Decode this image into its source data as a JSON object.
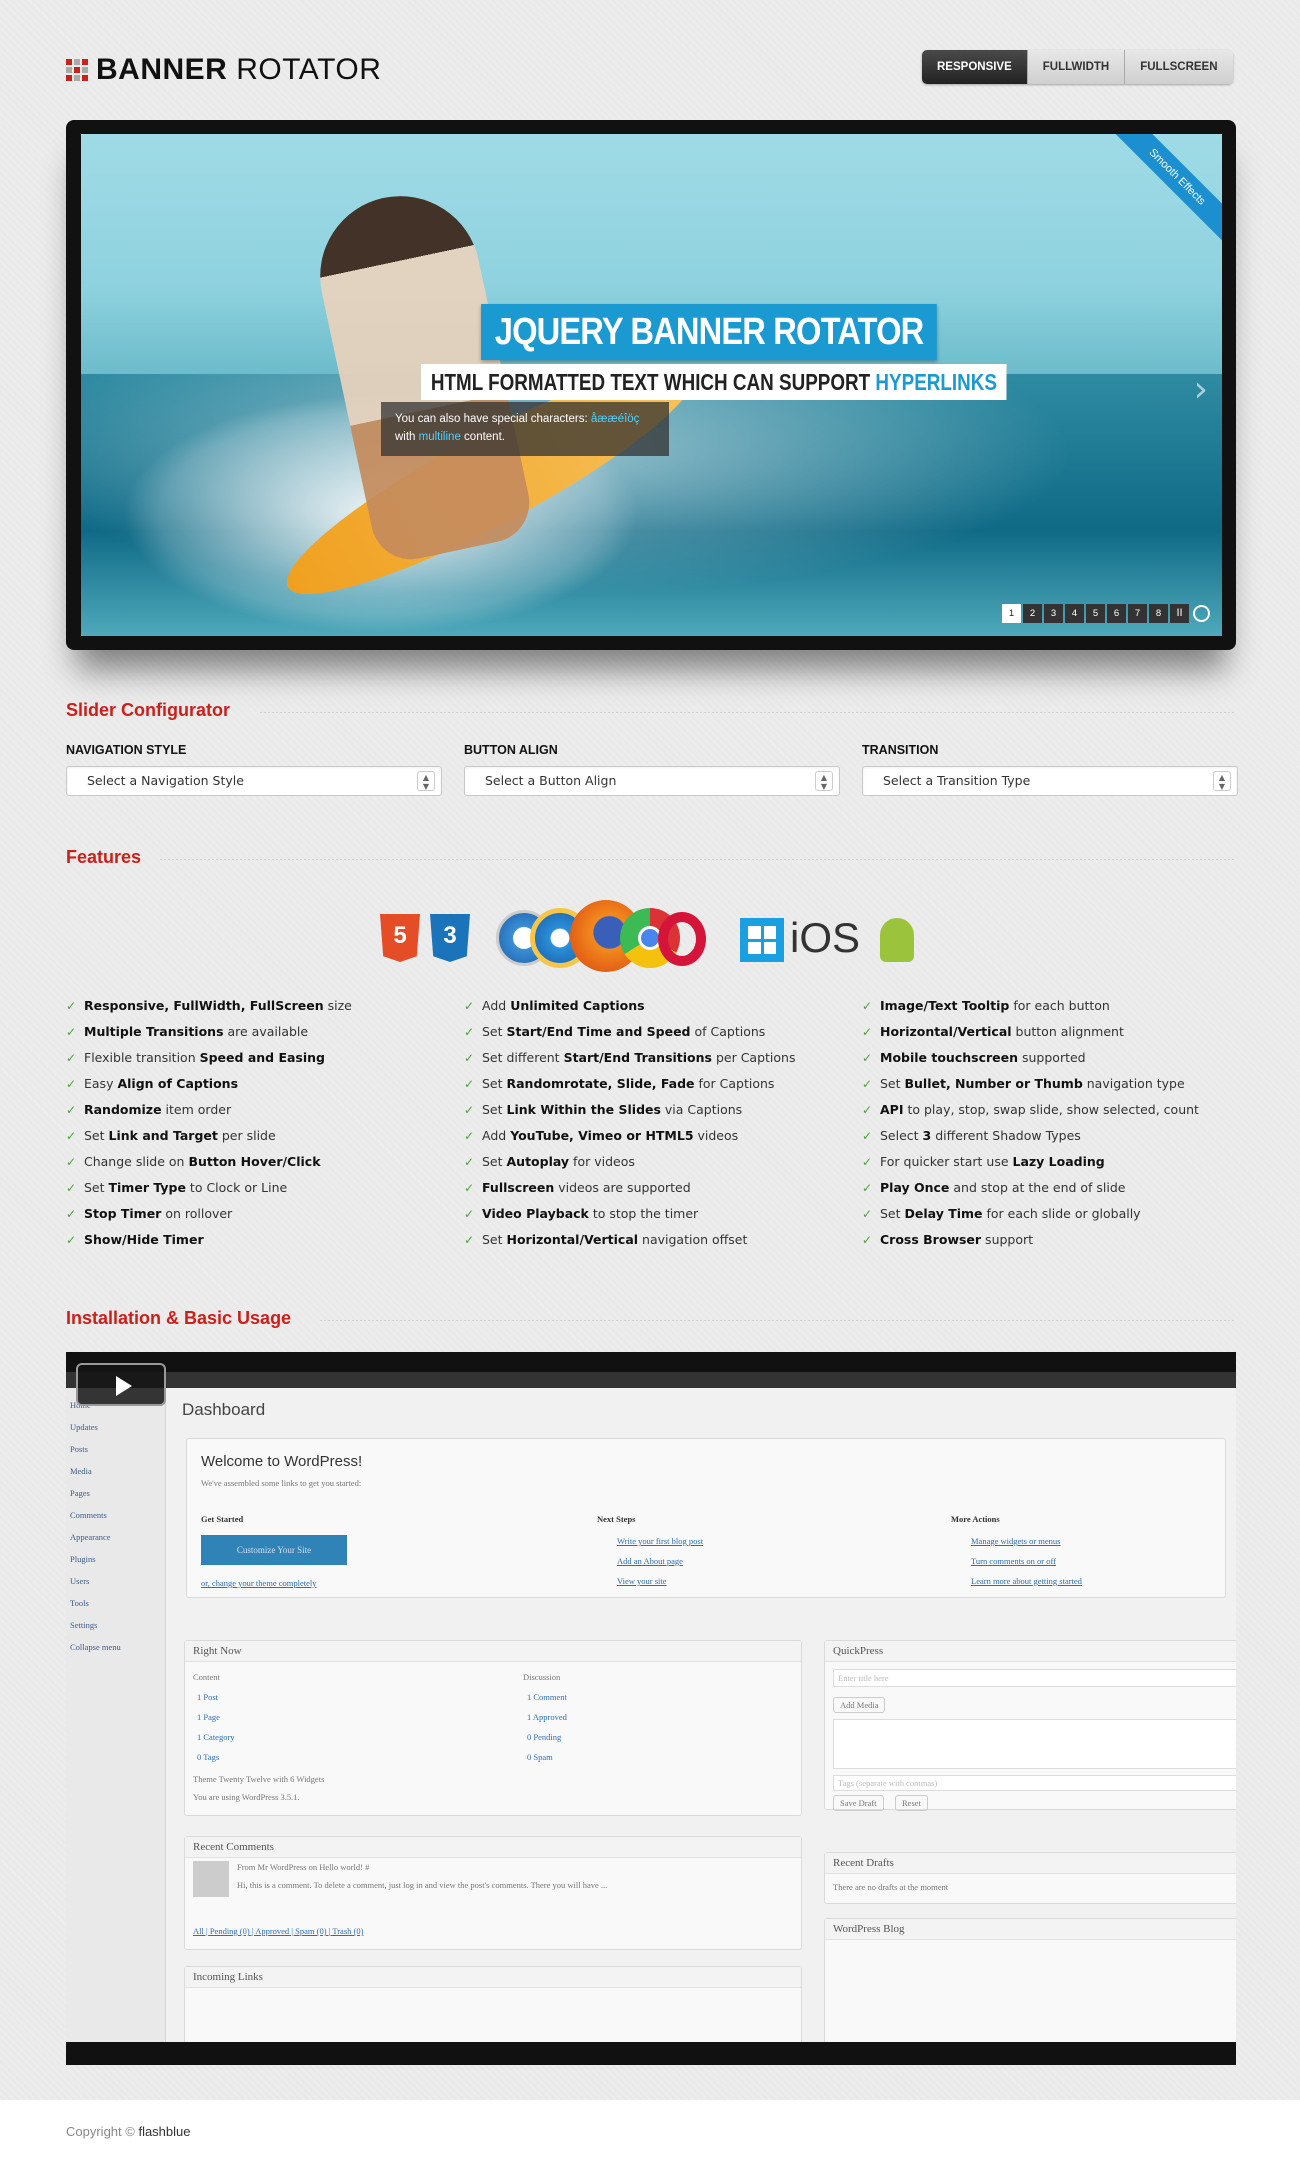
{
  "header": {
    "logo_bold": "BANNER",
    "logo_light": "ROTATOR",
    "modes": [
      "RESPONSIVE",
      "FULLWIDTH",
      "FULLSCREEN"
    ]
  },
  "banner": {
    "ribbon": "Smooth Effects",
    "caption_title": "JQUERY BANNER ROTATOR",
    "caption_sub": "HTML FORMATTED TEXT WHICH CAN SUPPORT",
    "caption_sub_highlight": "HYPERLINKS",
    "caption_text_1": "You can also have special characters:",
    "caption_text_chars": "åææéîöç",
    "caption_text_2": "with",
    "caption_text_hl": "multiline",
    "caption_text_3": "content.",
    "pages": [
      "1",
      "2",
      "3",
      "4",
      "5",
      "6",
      "7",
      "8"
    ],
    "current_page": "1",
    "pause": "II"
  },
  "configurator": {
    "title": "Slider Configurator",
    "fields": [
      {
        "label": "NAVIGATION STYLE",
        "placeholder": "Select a Navigation Style"
      },
      {
        "label": "BUTTON ALIGN",
        "placeholder": "Select a Button Align"
      },
      {
        "label": "TRANSITION",
        "placeholder": "Select a Transition Type"
      }
    ]
  },
  "features": {
    "title": "Features",
    "icons": [
      "html5",
      "css3",
      "safari",
      "ie",
      "firefox",
      "chrome",
      "opera",
      "windows",
      "iOS",
      "android"
    ],
    "col1": [
      [
        "",
        "Responsive, FullWidth, FullScreen",
        " size"
      ],
      [
        "",
        "Multiple Transitions",
        " are available"
      ],
      [
        "Flexible transition ",
        "Speed and Easing",
        ""
      ],
      [
        "Easy ",
        "Align of Captions",
        ""
      ],
      [
        "",
        "Randomize",
        " item order"
      ],
      [
        "Set ",
        "Link and Target",
        " per slide"
      ],
      [
        "Change slide on ",
        "Button Hover/Click",
        ""
      ],
      [
        "Set ",
        "Timer Type",
        " to Clock or Line"
      ],
      [
        "",
        "Stop Timer",
        " on rollover"
      ],
      [
        "",
        "Show/Hide Timer",
        ""
      ]
    ],
    "col2": [
      [
        "Add ",
        "Unlimited Captions",
        ""
      ],
      [
        "Set ",
        "Start/End Time and Speed",
        " of Captions"
      ],
      [
        "Set different ",
        "Start/End Transitions",
        " per Captions"
      ],
      [
        "Set ",
        "Randomrotate, Slide, Fade",
        " for Captions"
      ],
      [
        "Set ",
        "Link Within the Slides",
        " via Captions"
      ],
      [
        "Add ",
        "YouTube, Vimeo or HTML5",
        " videos"
      ],
      [
        "Set ",
        "Autoplay",
        " for videos"
      ],
      [
        "",
        "Fullscreen",
        " videos are supported"
      ],
      [
        "",
        "Video Playback",
        " to stop the timer"
      ],
      [
        "Set ",
        "Horizontal/Vertical",
        " navigation offset"
      ]
    ],
    "col3": [
      [
        "",
        "Image/Text Tooltip",
        " for each button"
      ],
      [
        "",
        "Horizontal/Vertical",
        " button alignment"
      ],
      [
        "",
        "Mobile touchscreen",
        " supported"
      ],
      [
        "Set ",
        "Bullet, Number or Thumb",
        " navigation type"
      ],
      [
        "",
        "API",
        " to play, stop, swap slide, show selected, count"
      ],
      [
        "Select ",
        "3",
        " different Shadow Types"
      ],
      [
        "For quicker start use ",
        "Lazy Loading",
        ""
      ],
      [
        "",
        "Play Once",
        " and stop at the end of slide"
      ],
      [
        "Set ",
        "Delay Time",
        " for each slide or globally"
      ],
      [
        "",
        "Cross Browser",
        " support"
      ]
    ]
  },
  "install": {
    "title": "Installation & Basic Usage",
    "wp": {
      "dashboard": "Dashboard",
      "welcome": "Welcome to WordPress!",
      "welcome_sub": "We've assembled some links to get you started:",
      "get_started": "Get Started",
      "customize": "Customize Your Site",
      "or_change": "or, change your theme completely",
      "next_steps": "Next Steps",
      "ns": [
        "Write your first blog post",
        "Add an About page",
        "View your site"
      ],
      "more_actions": "More Actions",
      "ma": [
        "Manage widgets or menus",
        "Turn comments on or off",
        "Learn more about getting started"
      ],
      "right_now": "Right Now",
      "content": "Content",
      "discussion": "Discussion",
      "rn_left": [
        "1 Post",
        "1 Page",
        "1 Category",
        "0 Tags"
      ],
      "rn_right": [
        "1 Comment",
        "1 Approved",
        "0 Pending",
        "0 Spam"
      ],
      "theme_line": "Theme Twenty Twelve with 6 Widgets",
      "version_line": "You are using WordPress 3.5.1.",
      "recent_comments": "Recent Comments",
      "rc_from": "From Mr WordPress on Hello world! #",
      "rc_text": "Hi, this is a comment. To delete a comment, just log in and view the post's comments. There you will have ...",
      "rc_links": "All | Pending (0) | Approved | Spam (0) | Trash (0)",
      "incoming": "Incoming Links",
      "quickpress": "QuickPress",
      "qp_title": "Enter title here",
      "qp_add_media": "Add Media",
      "qp_tags": "Tags (separate with commas)",
      "save_draft": "Save Draft",
      "reset": "Reset",
      "recent_drafts": "Recent Drafts",
      "no_drafts": "There are no drafts at the moment",
      "wp_blog": "WordPress Blog",
      "side": [
        "Home",
        "Updates",
        "Posts",
        "Media",
        "Pages",
        "Comments",
        "Appearance",
        "Plugins",
        "Users",
        "Tools",
        "Settings",
        "Collapse menu"
      ]
    }
  },
  "footer": {
    "copyright": "Copyright ©",
    "brand": "flashblue"
  }
}
